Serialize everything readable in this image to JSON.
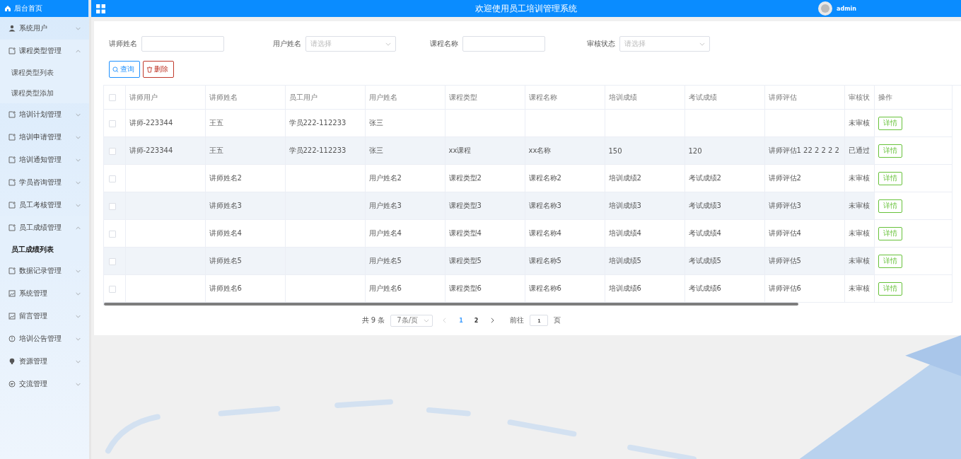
{
  "header": {
    "home_label": "后台首页",
    "title": "欢迎使用员工培训管理系统",
    "user": "admin"
  },
  "sidebar": {
    "items": [
      {
        "label": "系统用户",
        "expanded": false
      },
      {
        "label": "课程类型管理",
        "expanded": true,
        "children": [
          {
            "label": "课程类型列表",
            "selected": false
          },
          {
            "label": "课程类型添加",
            "selected": false
          }
        ]
      },
      {
        "label": "培训计划管理",
        "expanded": false
      },
      {
        "label": "培训申请管理",
        "expanded": false
      },
      {
        "label": "培训通知管理",
        "expanded": false
      },
      {
        "label": "学员咨询管理",
        "expanded": false
      },
      {
        "label": "员工考核管理",
        "expanded": false
      },
      {
        "label": "员工成绩管理",
        "expanded": true,
        "children": [
          {
            "label": "员工成绩列表",
            "selected": true
          }
        ]
      },
      {
        "label": "数据记录管理",
        "expanded": false
      },
      {
        "label": "系统管理",
        "expanded": false
      },
      {
        "label": "留言管理",
        "expanded": false
      },
      {
        "label": "培训公告管理",
        "expanded": false
      },
      {
        "label": "资源管理",
        "expanded": false
      },
      {
        "label": "交流管理",
        "expanded": false
      }
    ]
  },
  "filters": [
    {
      "label": "讲师姓名",
      "kind": "input"
    },
    {
      "label": "用户姓名",
      "kind": "select",
      "placeholder": "请选择"
    },
    {
      "label": "课程名称",
      "kind": "input"
    },
    {
      "label": "审核状态",
      "kind": "select",
      "placeholder": "请选择"
    }
  ],
  "buttons": [
    {
      "label": "查询",
      "kind": "search"
    },
    {
      "label": "删除",
      "kind": "delete"
    }
  ],
  "table": {
    "select_all_checked": false,
    "action_column": "操作",
    "columns": [
      "讲师用户",
      "讲师姓名",
      "员工用户",
      "用户姓名",
      "课程类型",
      "课程名称",
      "培训成绩",
      "考试成绩",
      "讲师评估",
      "审核状"
    ],
    "rows": [
      {
        "checked": false,
        "action": "详情",
        "cells": [
          "讲师-223344",
          "王五",
          "学员222-112233",
          "张三",
          null,
          null,
          null,
          null,
          null,
          "未审核"
        ]
      },
      {
        "checked": false,
        "action": "详情",
        "cells": [
          "讲师-223344",
          "王五",
          "学员222-112233",
          "张三",
          "xx课程",
          "xx名称",
          "150",
          "120",
          "讲师评估1 22 2 2 2 2",
          "已通过"
        ]
      },
      {
        "checked": false,
        "action": "详情",
        "cells": [
          null,
          "讲师姓名2",
          null,
          "用户姓名2",
          "课程类型2",
          "课程名称2",
          "培训成绩2",
          "考试成绩2",
          "讲师评估2",
          "未审核"
        ]
      },
      {
        "checked": false,
        "action": "详情",
        "cells": [
          null,
          "讲师姓名3",
          null,
          "用户姓名3",
          "课程类型3",
          "课程名称3",
          "培训成绩3",
          "考试成绩3",
          "讲师评估3",
          "未审核"
        ]
      },
      {
        "checked": false,
        "action": "详情",
        "cells": [
          null,
          "讲师姓名4",
          null,
          "用户姓名4",
          "课程类型4",
          "课程名称4",
          "培训成绩4",
          "考试成绩4",
          "讲师评估4",
          "未审核"
        ]
      },
      {
        "checked": false,
        "action": "详情",
        "cells": [
          null,
          "讲师姓名5",
          null,
          "用户姓名5",
          "课程类型5",
          "课程名称5",
          "培训成绩5",
          "考试成绩5",
          "讲师评估5",
          "未审核"
        ]
      },
      {
        "checked": false,
        "action": "详情",
        "cells": [
          null,
          "讲师姓名6",
          null,
          "用户姓名6",
          "课程类型6",
          "课程名称6",
          "培训成绩6",
          "考试成绩6",
          "讲师评估6",
          "未审核"
        ]
      }
    ]
  },
  "pagination": {
    "total": "共 9 条",
    "page_size": "7条/页",
    "prev_disabled": true,
    "pages": [
      {
        "label": "1",
        "selected": true
      },
      {
        "label": "2",
        "selected": false
      }
    ],
    "goto_label": "前往",
    "goto_value": "1",
    "page_unit": "页"
  }
}
